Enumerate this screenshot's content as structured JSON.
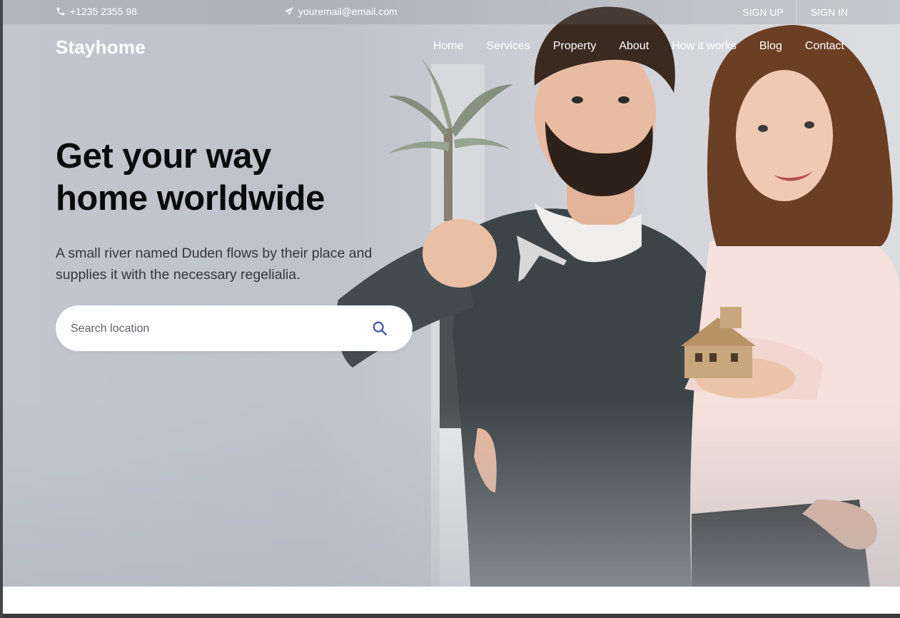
{
  "topbar": {
    "phone": "+1235 2355 98",
    "email": "youremail@email.com",
    "signup_label": "SIGN UP",
    "signin_label": "SIGN IN",
    "icons": {
      "phone": "phone-icon",
      "email": "paper-plane-icon"
    }
  },
  "brand": {
    "name": "Stayhome"
  },
  "nav": {
    "items": [
      "Home",
      "Services",
      "Property",
      "About",
      "How it works",
      "Blog",
      "Contact"
    ]
  },
  "hero": {
    "headline_line1": "Get your way",
    "headline_line2": "home worldwide",
    "subtext": "A small river named Duden flows by their place and supplies it with the necessary regelialia.",
    "photo": "couple-holding-keys-and-house-model"
  },
  "search": {
    "placeholder": "Search location",
    "value": "",
    "icon": "search-icon"
  },
  "colors": {
    "headline": "#0b0b0b",
    "subtext": "#35373c",
    "search_icon": "#4a5ea8",
    "white": "#ffffff"
  }
}
